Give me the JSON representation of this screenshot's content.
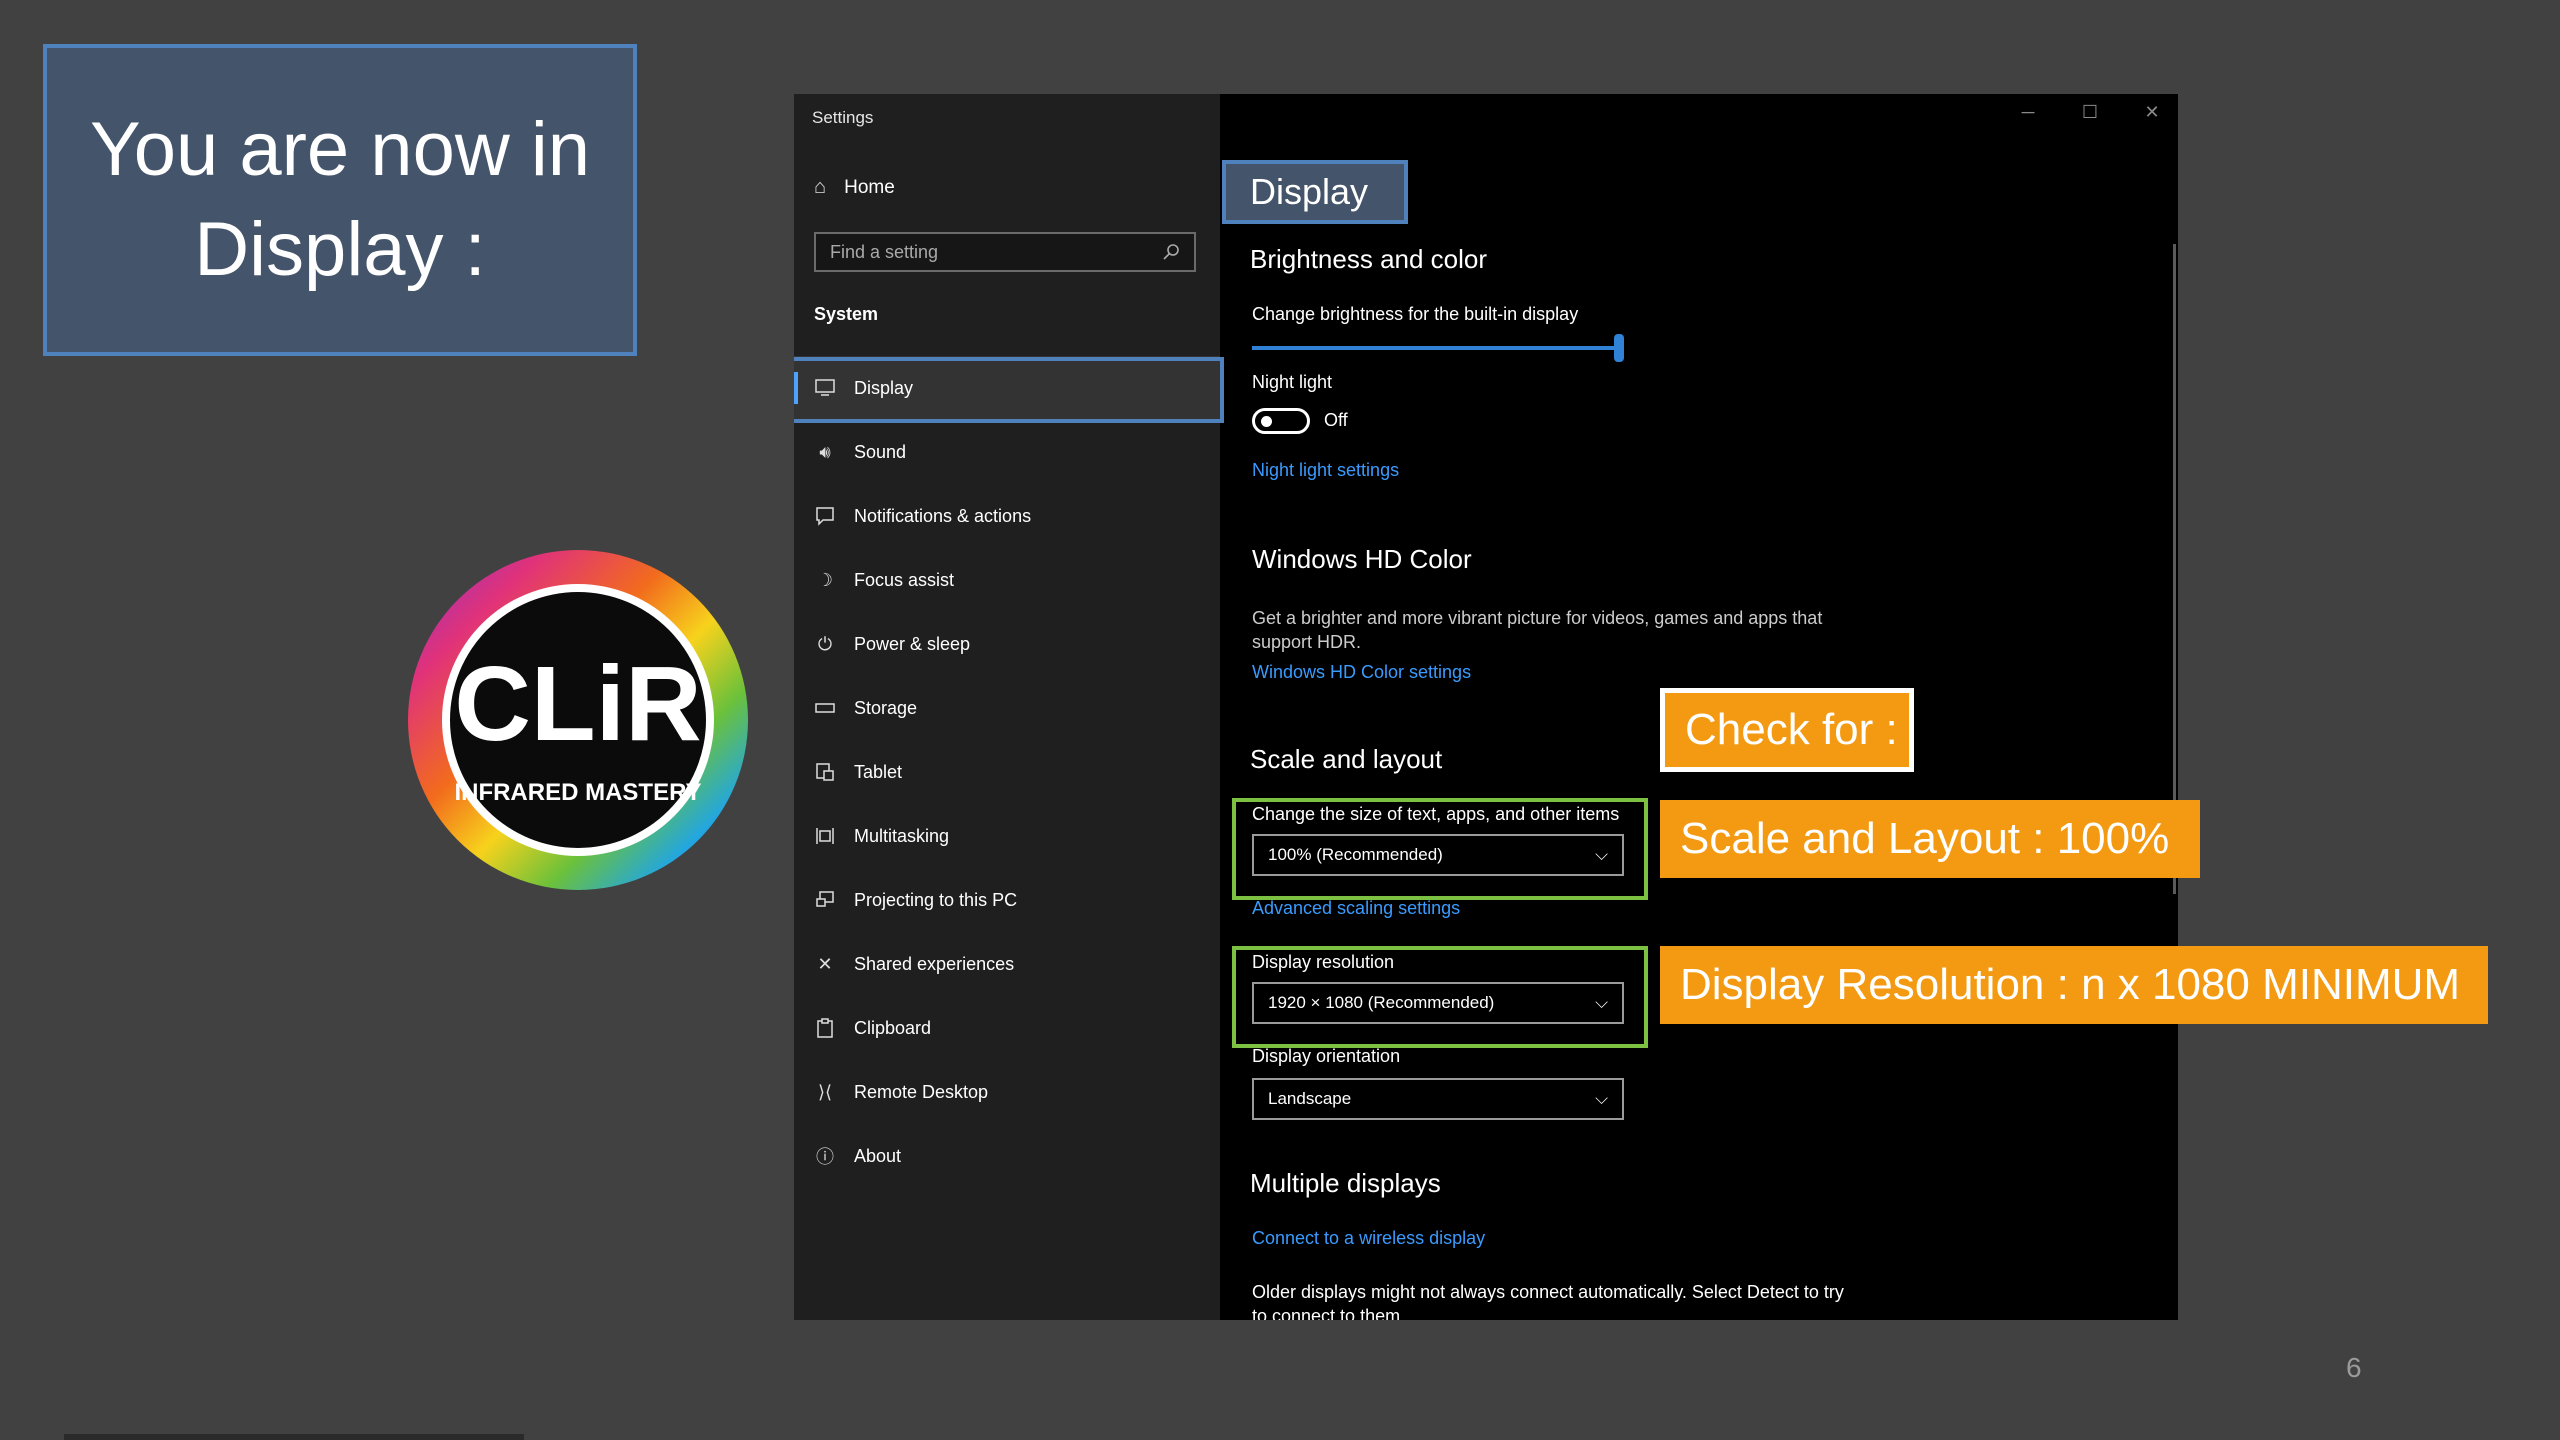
{
  "slide": {
    "heading": "You are now in Display :",
    "page_number": "6",
    "logo": {
      "text": "CLiR",
      "subtext": "INFRARED MASTERY"
    }
  },
  "window": {
    "title": "Settings",
    "controls": [
      "minimize-icon",
      "maximize-icon",
      "close-icon"
    ]
  },
  "sidebar": {
    "home": "Home",
    "search_placeholder": "Find a setting",
    "section": "System",
    "items": [
      {
        "label": "Display",
        "icon": "monitor-icon",
        "active": true
      },
      {
        "label": "Sound",
        "icon": "speaker-icon"
      },
      {
        "label": "Notifications & actions",
        "icon": "notification-icon"
      },
      {
        "label": "Focus assist",
        "icon": "moon-icon"
      },
      {
        "label": "Power & sleep",
        "icon": "power-icon"
      },
      {
        "label": "Storage",
        "icon": "storage-icon"
      },
      {
        "label": "Tablet",
        "icon": "tablet-icon"
      },
      {
        "label": "Multitasking",
        "icon": "multitasking-icon"
      },
      {
        "label": "Projecting to this PC",
        "icon": "projecting-icon"
      },
      {
        "label": "Shared experiences",
        "icon": "shared-icon"
      },
      {
        "label": "Clipboard",
        "icon": "clipboard-icon"
      },
      {
        "label": "Remote Desktop",
        "icon": "remote-icon"
      },
      {
        "label": "About",
        "icon": "info-icon"
      }
    ]
  },
  "main": {
    "title": "Display",
    "brightness": {
      "heading": "Brightness and color",
      "slider_label": "Change brightness for the built-in display",
      "brightness_level": 1.0,
      "night_light_label": "Night light",
      "night_light_state": "Off",
      "night_light_link": "Night light settings"
    },
    "hdr": {
      "heading": "Windows HD Color",
      "description": "Get a brighter and more vibrant picture for videos, games and apps that support HDR.",
      "link": "Windows HD Color settings"
    },
    "scale": {
      "heading": "Scale and layout",
      "size_label": "Change the size of text, apps, and other items",
      "size_value": "100% (Recommended)",
      "advanced_link": "Advanced scaling settings",
      "resolution_label": "Display resolution",
      "resolution_value": "1920 × 1080 (Recommended)",
      "orientation_label": "Display orientation",
      "orientation_value": "Landscape"
    },
    "multiple": {
      "heading": "Multiple displays",
      "link": "Connect to a wireless display",
      "description": "Older displays might not always connect automatically. Select Detect to try to connect to them."
    }
  },
  "callouts": {
    "check": "Check for :",
    "scale": "Scale and Layout : 100%",
    "resolution": "Display Resolution : n x 1080 MINIMUM"
  },
  "colors": {
    "slide_bg": "#414141",
    "title_box": "#44546a",
    "outline_blue": "#4f81bd",
    "callout_orange": "#f39a12",
    "highlight_green": "#7cc142",
    "link_blue": "#3a9bff"
  }
}
